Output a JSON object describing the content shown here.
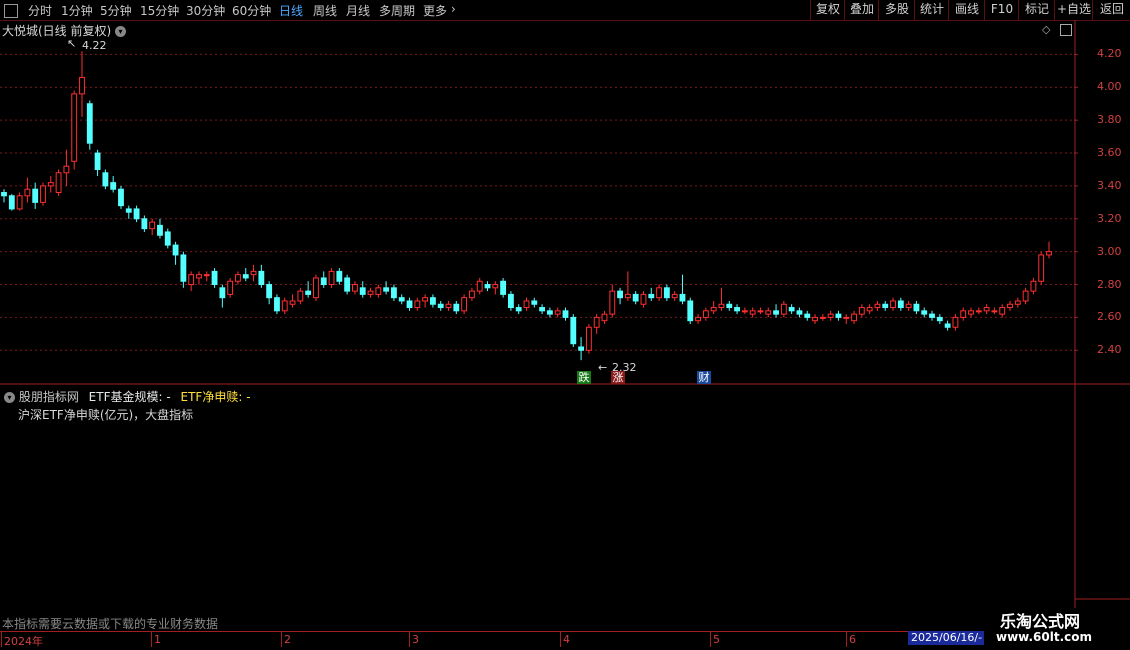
{
  "toolbar": {
    "periods": [
      "分时",
      "1分钟",
      "5分钟",
      "15分钟",
      "30分钟",
      "60分钟",
      "日线",
      "周线",
      "月线",
      "多周期",
      "更多"
    ],
    "active": "日线",
    "right_buttons": [
      "复权",
      "叠加",
      "多股",
      "统计",
      "画线",
      "F10",
      "标记",
      "+自选",
      "返回"
    ]
  },
  "main": {
    "title": "大悦城(日线 前复权)",
    "high_label": "4.22",
    "low_label": "2.32",
    "tags": [
      {
        "text": "跌",
        "color": "#20a020"
      },
      {
        "text": "涨",
        "color": "#c02020"
      },
      {
        "text": "财",
        "color": "#2060c0"
      }
    ],
    "price_ticks": [
      "4.20",
      "4.00",
      "3.80",
      "3.60",
      "3.40",
      "3.20",
      "3.00",
      "2.80",
      "2.60",
      "2.40"
    ]
  },
  "indicator": {
    "title_a": "股朋指标网",
    "title_b": "ETF基金规模: -",
    "title_c": "ETF净申赎: -",
    "subtitle": "沪深ETF净申赎(亿元)，大盘指标"
  },
  "footer": {
    "note": "本指标需要云数据或下载的专业财务数据",
    "dates": [
      "2024年",
      "1",
      "2",
      "3",
      "4",
      "5",
      "6"
    ],
    "current_date": "2025/06/16/-"
  },
  "watermark": {
    "top": "乐淘公式网",
    "bottom": "www.60lt.com"
  },
  "colors": {
    "up": "#ff3030",
    "down": "#54ffff",
    "grid": "#7a1a1a",
    "axis": "#a02020"
  },
  "chart_data": {
    "type": "candlestick",
    "ylim": [
      2.28,
      4.3
    ],
    "candles": [
      [
        3.36,
        3.38,
        3.3,
        3.34
      ],
      [
        3.34,
        3.35,
        3.25,
        3.26
      ],
      [
        3.26,
        3.36,
        3.25,
        3.34
      ],
      [
        3.34,
        3.45,
        3.3,
        3.38
      ],
      [
        3.38,
        3.42,
        3.26,
        3.3
      ],
      [
        3.3,
        3.42,
        3.28,
        3.4
      ],
      [
        3.4,
        3.46,
        3.36,
        3.42
      ],
      [
        3.36,
        3.5,
        3.34,
        3.48
      ],
      [
        3.48,
        3.62,
        3.4,
        3.52
      ],
      [
        3.55,
        3.98,
        3.5,
        3.96
      ],
      [
        3.96,
        4.22,
        3.82,
        4.06
      ],
      [
        3.9,
        3.92,
        3.62,
        3.66
      ],
      [
        3.6,
        3.62,
        3.46,
        3.5
      ],
      [
        3.48,
        3.5,
        3.38,
        3.4
      ],
      [
        3.42,
        3.46,
        3.36,
        3.38
      ],
      [
        3.38,
        3.4,
        3.26,
        3.28
      ],
      [
        3.26,
        3.28,
        3.2,
        3.24
      ],
      [
        3.26,
        3.28,
        3.18,
        3.2
      ],
      [
        3.2,
        3.22,
        3.12,
        3.14
      ],
      [
        3.14,
        3.2,
        3.1,
        3.18
      ],
      [
        3.16,
        3.2,
        3.08,
        3.1
      ],
      [
        3.12,
        3.14,
        3.02,
        3.04
      ],
      [
        3.04,
        3.06,
        2.92,
        2.98
      ],
      [
        2.98,
        3.0,
        2.78,
        2.82
      ],
      [
        2.8,
        2.88,
        2.76,
        2.86
      ],
      [
        2.84,
        2.88,
        2.8,
        2.86
      ],
      [
        2.86,
        2.88,
        2.82,
        2.86
      ],
      [
        2.88,
        2.9,
        2.78,
        2.8
      ],
      [
        2.78,
        2.8,
        2.66,
        2.72
      ],
      [
        2.74,
        2.84,
        2.72,
        2.82
      ],
      [
        2.82,
        2.88,
        2.8,
        2.86
      ],
      [
        2.86,
        2.9,
        2.82,
        2.84
      ],
      [
        2.86,
        2.92,
        2.82,
        2.88
      ],
      [
        2.88,
        2.92,
        2.78,
        2.8
      ],
      [
        2.8,
        2.82,
        2.68,
        2.72
      ],
      [
        2.72,
        2.74,
        2.62,
        2.64
      ],
      [
        2.64,
        2.72,
        2.62,
        2.7
      ],
      [
        2.68,
        2.74,
        2.66,
        2.7
      ],
      [
        2.7,
        2.78,
        2.68,
        2.76
      ],
      [
        2.76,
        2.82,
        2.72,
        2.74
      ],
      [
        2.72,
        2.86,
        2.7,
        2.84
      ],
      [
        2.84,
        2.88,
        2.78,
        2.8
      ],
      [
        2.8,
        2.9,
        2.78,
        2.88
      ],
      [
        2.88,
        2.9,
        2.8,
        2.82
      ],
      [
        2.84,
        2.86,
        2.74,
        2.76
      ],
      [
        2.76,
        2.82,
        2.74,
        2.8
      ],
      [
        2.78,
        2.82,
        2.72,
        2.74
      ],
      [
        2.74,
        2.78,
        2.72,
        2.76
      ],
      [
        2.74,
        2.8,
        2.72,
        2.78
      ],
      [
        2.78,
        2.82,
        2.74,
        2.76
      ],
      [
        2.78,
        2.8,
        2.7,
        2.72
      ],
      [
        2.72,
        2.74,
        2.68,
        2.7
      ],
      [
        2.7,
        2.72,
        2.64,
        2.66
      ],
      [
        2.66,
        2.72,
        2.64,
        2.7
      ],
      [
        2.7,
        2.74,
        2.66,
        2.72
      ],
      [
        2.72,
        2.74,
        2.66,
        2.68
      ],
      [
        2.68,
        2.7,
        2.64,
        2.66
      ],
      [
        2.66,
        2.7,
        2.64,
        2.68
      ],
      [
        2.68,
        2.7,
        2.62,
        2.64
      ],
      [
        2.64,
        2.74,
        2.62,
        2.72
      ],
      [
        2.72,
        2.78,
        2.7,
        2.76
      ],
      [
        2.76,
        2.84,
        2.74,
        2.82
      ],
      [
        2.8,
        2.82,
        2.76,
        2.78
      ],
      [
        2.78,
        2.82,
        2.74,
        2.8
      ],
      [
        2.82,
        2.84,
        2.72,
        2.74
      ],
      [
        2.74,
        2.76,
        2.64,
        2.66
      ],
      [
        2.66,
        2.68,
        2.62,
        2.64
      ],
      [
        2.66,
        2.72,
        2.64,
        2.7
      ],
      [
        2.7,
        2.72,
        2.66,
        2.68
      ],
      [
        2.66,
        2.68,
        2.62,
        2.64
      ],
      [
        2.64,
        2.66,
        2.6,
        2.62
      ],
      [
        2.62,
        2.66,
        2.6,
        2.64
      ],
      [
        2.64,
        2.66,
        2.58,
        2.6
      ],
      [
        2.6,
        2.62,
        2.42,
        2.44
      ],
      [
        2.42,
        2.48,
        2.34,
        2.4
      ],
      [
        2.4,
        2.56,
        2.38,
        2.54
      ],
      [
        2.54,
        2.62,
        2.5,
        2.6
      ],
      [
        2.58,
        2.64,
        2.56,
        2.62
      ],
      [
        2.62,
        2.8,
        2.6,
        2.76
      ],
      [
        2.76,
        2.78,
        2.68,
        2.72
      ],
      [
        2.72,
        2.88,
        2.7,
        2.74
      ],
      [
        2.74,
        2.76,
        2.68,
        2.7
      ],
      [
        2.68,
        2.76,
        2.66,
        2.74
      ],
      [
        2.74,
        2.78,
        2.7,
        2.72
      ],
      [
        2.72,
        2.8,
        2.7,
        2.78
      ],
      [
        2.78,
        2.8,
        2.7,
        2.72
      ],
      [
        2.72,
        2.76,
        2.7,
        2.74
      ],
      [
        2.74,
        2.86,
        2.68,
        2.7
      ],
      [
        2.7,
        2.72,
        2.56,
        2.58
      ],
      [
        2.58,
        2.62,
        2.56,
        2.6
      ],
      [
        2.6,
        2.66,
        2.58,
        2.64
      ],
      [
        2.64,
        2.7,
        2.62,
        2.66
      ],
      [
        2.66,
        2.78,
        2.64,
        2.68
      ],
      [
        2.68,
        2.7,
        2.64,
        2.66
      ],
      [
        2.66,
        2.68,
        2.62,
        2.64
      ],
      [
        2.64,
        2.66,
        2.62,
        2.64
      ],
      [
        2.62,
        2.66,
        2.6,
        2.64
      ],
      [
        2.64,
        2.66,
        2.62,
        2.64
      ],
      [
        2.62,
        2.66,
        2.6,
        2.64
      ],
      [
        2.64,
        2.68,
        2.6,
        2.62
      ],
      [
        2.62,
        2.7,
        2.6,
        2.68
      ],
      [
        2.66,
        2.68,
        2.62,
        2.64
      ],
      [
        2.64,
        2.66,
        2.6,
        2.62
      ],
      [
        2.62,
        2.64,
        2.58,
        2.6
      ],
      [
        2.58,
        2.62,
        2.56,
        2.6
      ],
      [
        2.6,
        2.62,
        2.58,
        2.6
      ],
      [
        2.6,
        2.64,
        2.58,
        2.62
      ],
      [
        2.62,
        2.64,
        2.58,
        2.6
      ],
      [
        2.6,
        2.62,
        2.56,
        2.6
      ],
      [
        2.58,
        2.64,
        2.56,
        2.62
      ],
      [
        2.62,
        2.68,
        2.6,
        2.66
      ],
      [
        2.64,
        2.68,
        2.62,
        2.66
      ],
      [
        2.66,
        2.7,
        2.64,
        2.68
      ],
      [
        2.68,
        2.7,
        2.64,
        2.66
      ],
      [
        2.66,
        2.72,
        2.64,
        2.7
      ],
      [
        2.7,
        2.72,
        2.64,
        2.66
      ],
      [
        2.66,
        2.7,
        2.64,
        2.68
      ],
      [
        2.68,
        2.7,
        2.62,
        2.64
      ],
      [
        2.64,
        2.66,
        2.6,
        2.62
      ],
      [
        2.62,
        2.64,
        2.58,
        2.6
      ],
      [
        2.6,
        2.62,
        2.56,
        2.58
      ],
      [
        2.56,
        2.58,
        2.52,
        2.54
      ],
      [
        2.54,
        2.62,
        2.52,
        2.6
      ],
      [
        2.6,
        2.66,
        2.58,
        2.64
      ],
      [
        2.62,
        2.66,
        2.6,
        2.64
      ],
      [
        2.64,
        2.66,
        2.62,
        2.64
      ],
      [
        2.64,
        2.68,
        2.62,
        2.66
      ],
      [
        2.64,
        2.66,
        2.62,
        2.64
      ],
      [
        2.62,
        2.68,
        2.6,
        2.66
      ],
      [
        2.66,
        2.7,
        2.64,
        2.68
      ],
      [
        2.68,
        2.72,
        2.66,
        2.7
      ],
      [
        2.7,
        2.78,
        2.68,
        2.76
      ],
      [
        2.76,
        2.84,
        2.74,
        2.82
      ],
      [
        2.82,
        3.0,
        2.8,
        2.98
      ],
      [
        2.98,
        3.06,
        2.96,
        3.0
      ]
    ]
  }
}
